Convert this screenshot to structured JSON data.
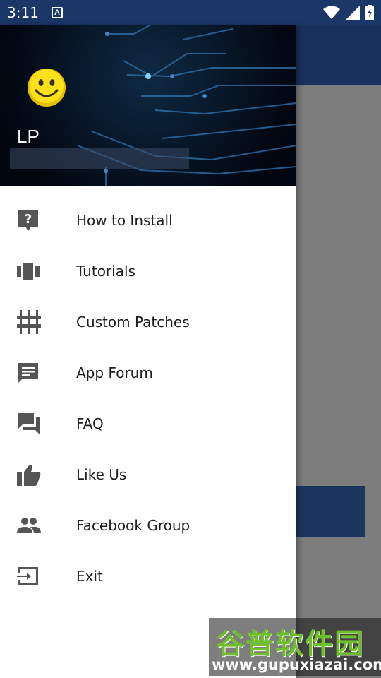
{
  "status_bar": {
    "time": "3:11",
    "notification_icon": "A"
  },
  "drawer": {
    "header": {
      "user_name": "LP",
      "avatar_icon": "smiley-icon"
    },
    "items": [
      {
        "label": "How to Install",
        "icon": "help-icon"
      },
      {
        "label": "Tutorials",
        "icon": "carousel-icon"
      },
      {
        "label": "Custom Patches",
        "icon": "equalizer-icon"
      },
      {
        "label": "App Forum",
        "icon": "message-icon"
      },
      {
        "label": "FAQ",
        "icon": "forum-icon"
      },
      {
        "label": "Like Us",
        "icon": "thumb-up-icon"
      },
      {
        "label": "Facebook Group",
        "icon": "group-icon"
      },
      {
        "label": "Exit",
        "icon": "exit-icon"
      }
    ]
  },
  "watermark": {
    "title": "谷普软件园",
    "url": "www.gupuxiazai.com"
  },
  "colors": {
    "primary_dark": "#1a3768",
    "primary": "#17305e",
    "icon": "#555555"
  }
}
